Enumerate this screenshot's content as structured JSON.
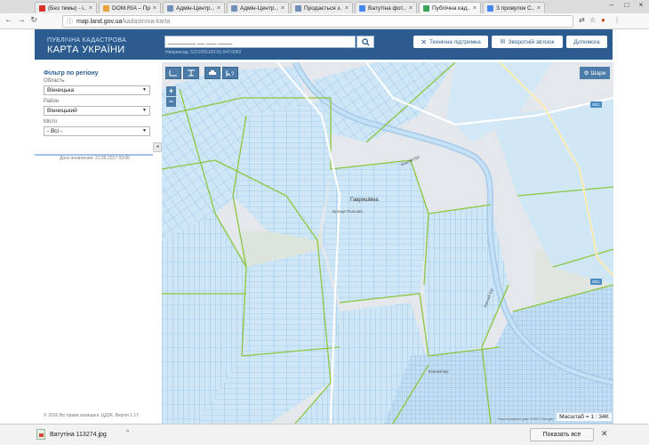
{
  "browser": {
    "tabs": [
      {
        "label": "(Без темы) - i...",
        "favicon": "gmail-icon",
        "color": "#d93025"
      },
      {
        "label": "DOM.RIA – Пр...",
        "favicon": "domria-icon",
        "color": "#e8a33a"
      },
      {
        "label": "Адмін-Центр...",
        "favicon": "site-icon",
        "color": "#6f8fb6"
      },
      {
        "label": "Адмін-Центр...",
        "favicon": "site-icon",
        "color": "#6f8fb6"
      },
      {
        "label": "Продається з...",
        "favicon": "site-icon",
        "color": "#6f8fb6"
      },
      {
        "label": "Ватутіна фот...",
        "favicon": "google-icon",
        "color": "#4285f4"
      },
      {
        "label": "Публічна кад...",
        "favicon": "cadastre-icon",
        "color": "#3ca55c",
        "active": true
      },
      {
        "label": "З провулок С...",
        "favicon": "google-icon",
        "color": "#4285f4"
      }
    ],
    "url_host": "map.land.gov.ua",
    "url_path": "/kadastrova-karta"
  },
  "header": {
    "brand_line1": "ПУБЛІЧНА КАДАСТРОВА",
    "brand_line2": "КАРТА УКРАЇНИ",
    "search_value": "________ __ ___ ____",
    "search_hint": "Наприклад: 5221055100:01:047:0062",
    "tech_support": "Технічна підтримка",
    "feedback": "Зворотній зв'язок",
    "help": "Допомога"
  },
  "sidebar": {
    "title": "Фільтр по регіону",
    "oblast_label": "Область",
    "oblast_value": "Вінницька",
    "rayon_label": "Район",
    "rayon_value": "Вінницький",
    "city_label": "Місто",
    "city_value": "- Всі -",
    "updated": "Дата оновлення: 21.05.2017 03:00",
    "footer": "© 2016 Всі права захищені. ЦДЗК. Версія 1.17"
  },
  "map": {
    "layers_label": "Шари",
    "scale_label": "Масштаб = 1 : 34K",
    "village": "Гавришівка",
    "village_street": "вулиця Польова",
    "river": "Южний Буг",
    "road1": "М21",
    "road2": "М21",
    "attribution": "Картографічні дані ©2017 Google"
  },
  "downloads": {
    "filename": "Ватутіна 113274.jpg",
    "show_all": "Показать все"
  },
  "colors": {
    "header_bg": "#2c5c8f",
    "parcel_fill": "#bfe0f5",
    "parcel_stroke": "#7cb4e0",
    "boundary_green": "#8cc63f"
  }
}
